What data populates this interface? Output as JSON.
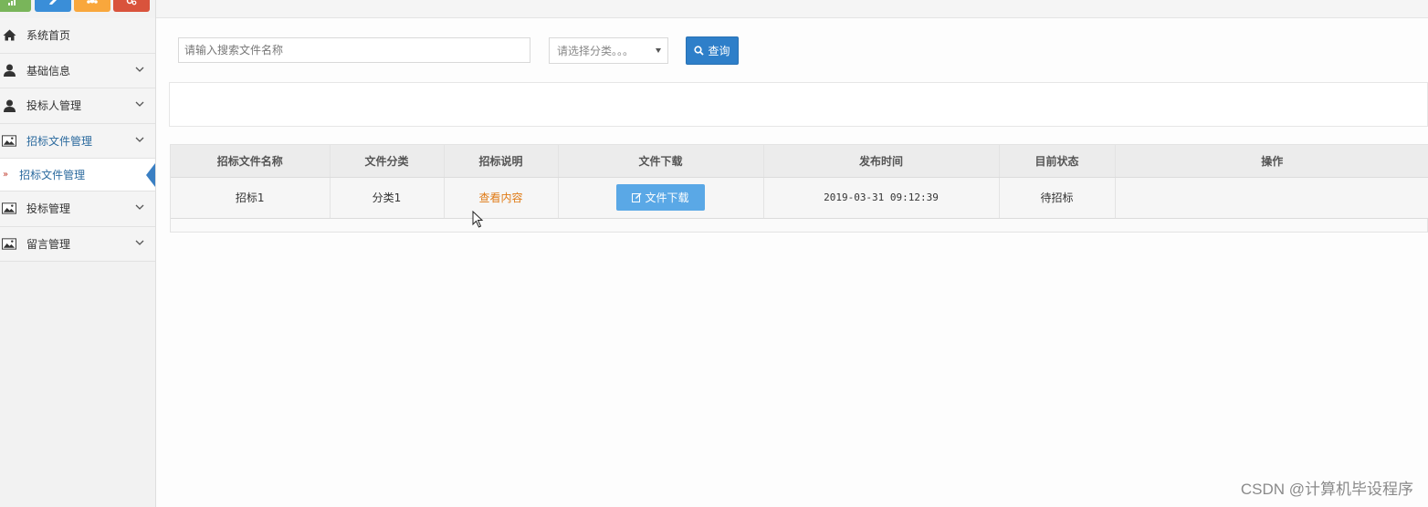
{
  "colors": {
    "accent": "#2e7fc9",
    "download_btn": "#5aa8e6",
    "link_orange": "#e07b16",
    "active_marker": "#3a7fc3"
  },
  "shortcuts": [
    {
      "icon": "bar-chart-icon",
      "color": "#79b55a"
    },
    {
      "icon": "pencil-icon",
      "color": "#3a8ed8"
    },
    {
      "icon": "users-icon",
      "color": "#f9a73c"
    },
    {
      "icon": "gears-icon",
      "color": "#d9533c"
    }
  ],
  "sidebar": {
    "items": [
      {
        "label": "系统首页",
        "icon": "home-icon"
      },
      {
        "label": "基础信息",
        "icon": "user-icon"
      },
      {
        "label": "投标人管理",
        "icon": "user-icon"
      },
      {
        "label": "招标文件管理",
        "icon": "picture-icon"
      },
      {
        "label": "投标管理",
        "icon": "picture-icon"
      },
      {
        "label": "留言管理",
        "icon": "picture-icon"
      }
    ],
    "sub_item": {
      "label": "招标文件管理"
    }
  },
  "search": {
    "placeholder": "请输入搜索文件名称",
    "category_placeholder": "请选择分类。。。",
    "query_label": "查询"
  },
  "table": {
    "headers": [
      "招标文件名称",
      "文件分类",
      "招标说明",
      "文件下载",
      "发布时间",
      "目前状态",
      "操作"
    ],
    "rows": [
      {
        "name": "招标1",
        "category": "分类1",
        "description_link": "查看内容",
        "download_label": "文件下载",
        "published": "2019-03-31 09:12:39",
        "status": "待招标",
        "actions": ""
      }
    ]
  },
  "watermark": "CSDN @计算机毕设程序"
}
